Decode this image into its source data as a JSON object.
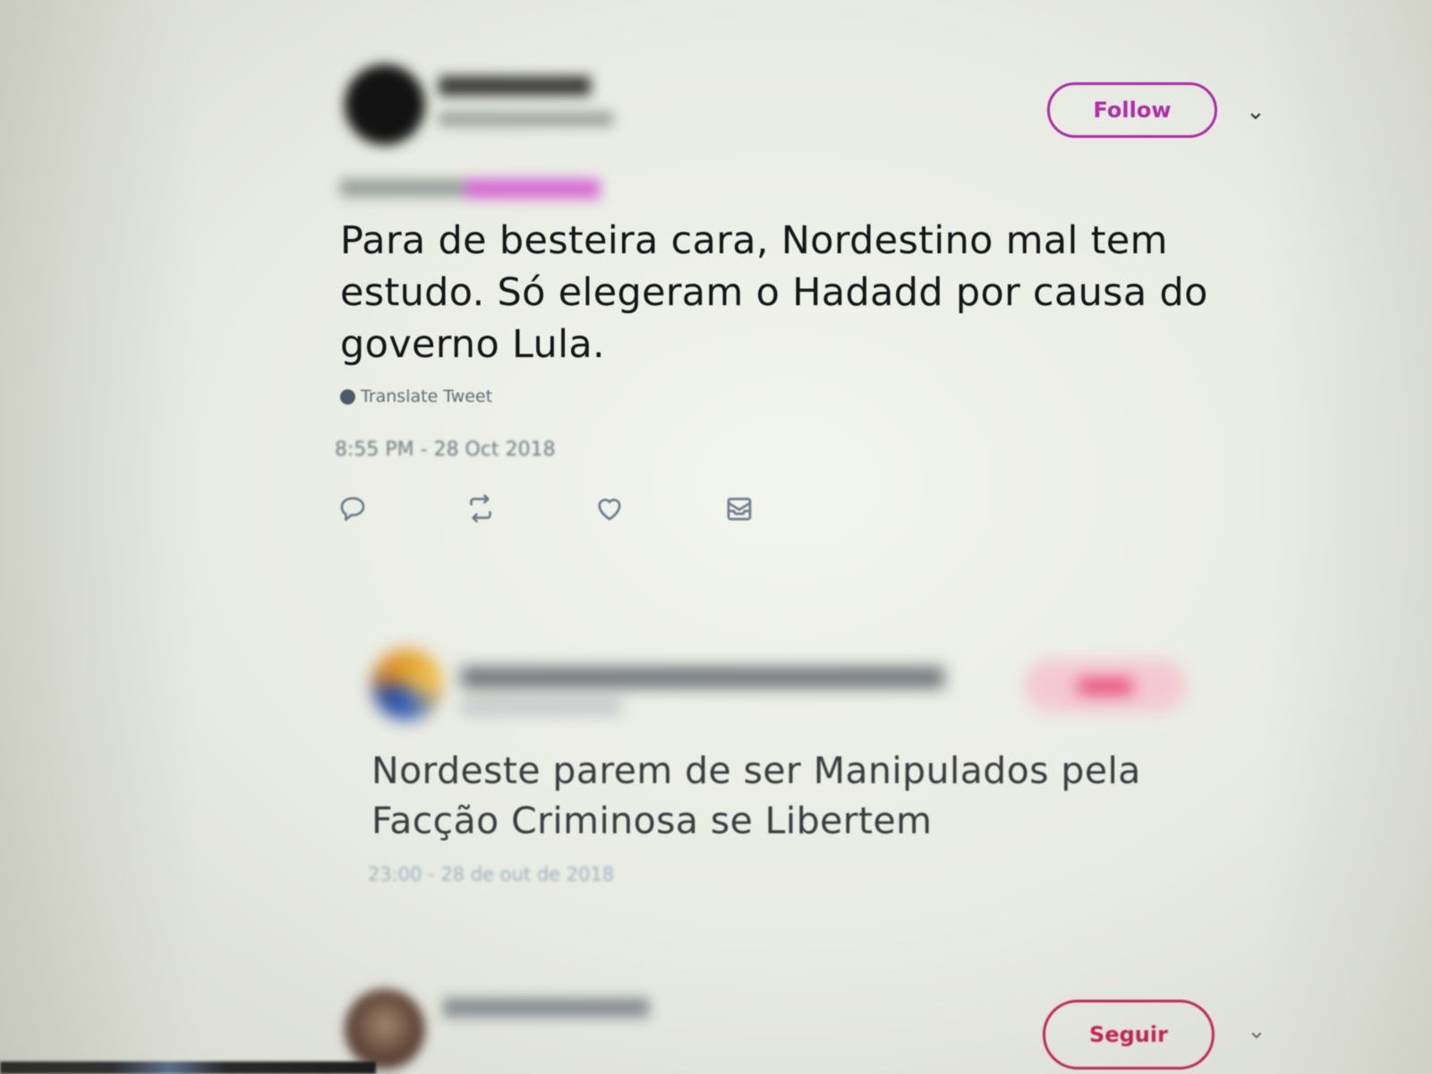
{
  "tweet1": {
    "follow_label": "Follow",
    "text": "Para de besteira cara, Nordestino mal tem estudo. Só elegeram o Hadadd por causa do governo Lula.",
    "translate_label": "Translate Tweet",
    "timestamp": "8:55 PM - 28 Oct 2018",
    "actions": [
      "reply-icon",
      "retweet-icon",
      "like-icon",
      "message-icon"
    ]
  },
  "tweet2": {
    "text": "Nordeste parem de ser Manipulados pela Facção Criminosa se Libertem",
    "timestamp": "23:00 - 28 de out de 2018"
  },
  "tweet3": {
    "follow_label": "Seguir"
  },
  "colors": {
    "follow_accent": "#b02ca8",
    "seguir_accent": "#c0264e",
    "icon_gray": "#6b7d89"
  }
}
